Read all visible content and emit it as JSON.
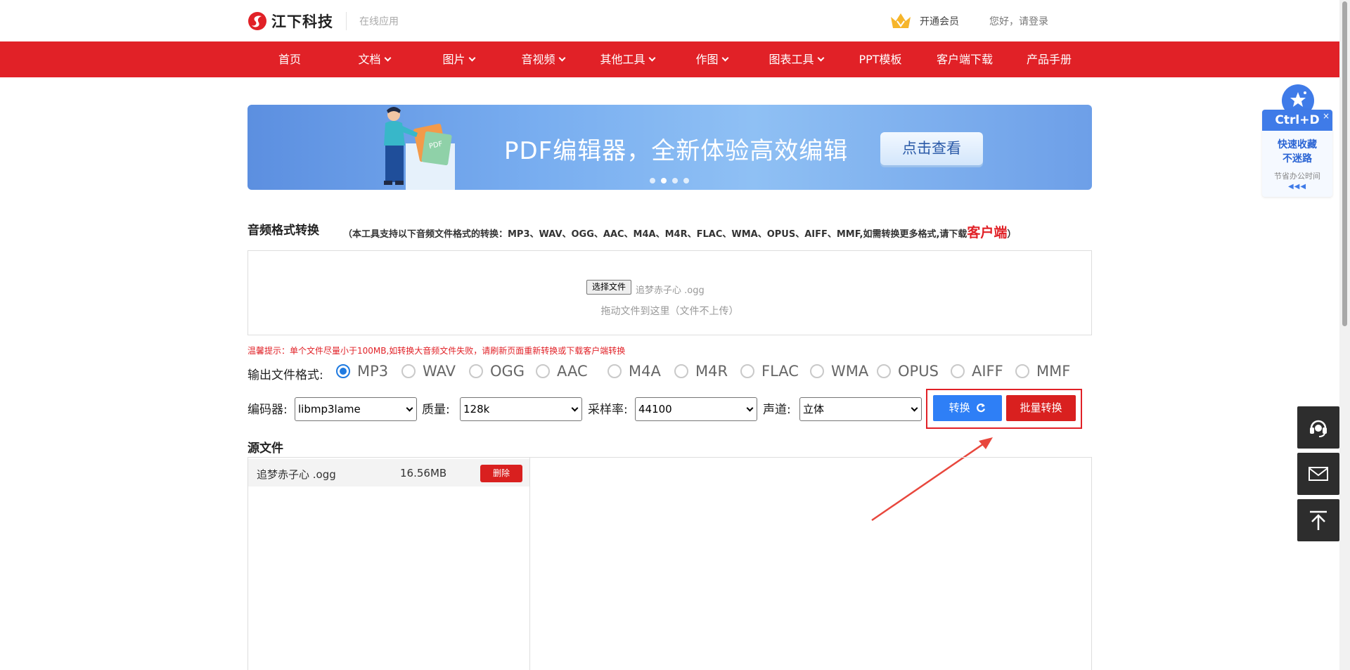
{
  "header": {
    "brand": "江下科技",
    "brand_sub": "在线应用",
    "vip_label": "开通会员",
    "login_label": "您好，请登录"
  },
  "nav": {
    "items": [
      {
        "label": "首页",
        "dropdown": false
      },
      {
        "label": "文档",
        "dropdown": true
      },
      {
        "label": "图片",
        "dropdown": true
      },
      {
        "label": "音视频",
        "dropdown": true
      },
      {
        "label": "其他工具",
        "dropdown": true
      },
      {
        "label": "作图",
        "dropdown": true
      },
      {
        "label": "图表工具",
        "dropdown": true
      },
      {
        "label": "PPT模板",
        "dropdown": false
      },
      {
        "label": "客户端下载",
        "dropdown": false
      },
      {
        "label": "产品手册",
        "dropdown": false
      }
    ]
  },
  "banner": {
    "title": "PDF编辑器，全新体验高效编辑",
    "button": "点击查看",
    "art_label": "PDF",
    "slides": 4,
    "active_slide": 1
  },
  "tool": {
    "title": "音频格式转换",
    "note_prefix": "（本工具支持以下音频文件格式的转换：MP3、WAV、OGG、AAC、M4A、M4R、FLAC、WMA、OPUS、AIFF、MMF,如需转换更多格式,请下载",
    "note_link": "客户端",
    "note_suffix": "）"
  },
  "upload": {
    "choose_button": "选择文件",
    "file_name": "追梦赤子心 .ogg",
    "drop_hint": "拖动文件到这里（文件不上传）"
  },
  "warning": "温馨提示：单个文件尽量小于100MB,如转换大音频文件失败，请刷新页面重新转换或下载客户端转换",
  "formats": {
    "label": "输出文件格式:",
    "options": [
      "MP3",
      "WAV",
      "OGG",
      "AAC",
      "M4A",
      "M4R",
      "FLAC",
      "WMA",
      "OPUS",
      "AIFF",
      "MMF"
    ],
    "selected": "MP3"
  },
  "settings": {
    "encoder_label": "编码器:",
    "encoder_value": "libmp3lame",
    "quality_label": "质量:",
    "quality_value": "128k",
    "samplerate_label": "采样率:",
    "samplerate_value": "44100",
    "channel_label": "声道:",
    "channel_value": "立体"
  },
  "actions": {
    "convert": "转换",
    "batch": "批量转换"
  },
  "source": {
    "title": "源文件",
    "files": [
      {
        "name": "追梦赤子心 .ogg",
        "size": "16.56MB",
        "delete": "删除"
      }
    ]
  },
  "float": {
    "shortcut": "Ctrl+D",
    "line1": "快速收藏",
    "line1b": "不迷路",
    "line2": "节省办公时间",
    "close": "×"
  },
  "colors": {
    "brand_red": "#e12127",
    "primary_blue": "#2e7ff6",
    "radio_blue": "#1f7ae0"
  }
}
